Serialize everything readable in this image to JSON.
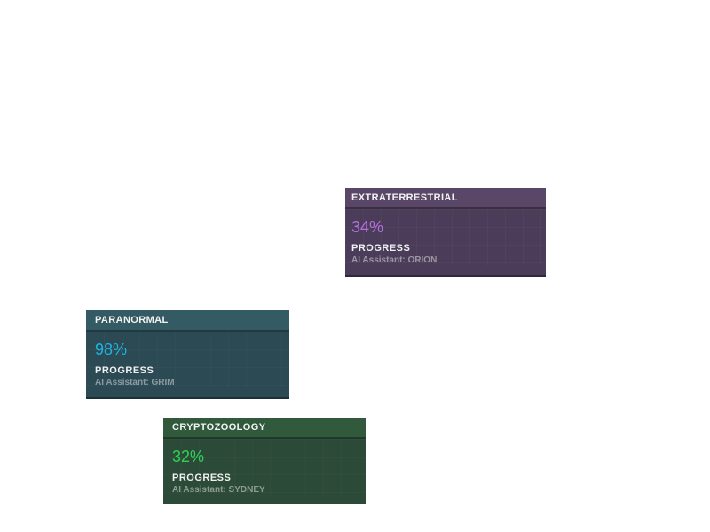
{
  "cards": [
    {
      "title": "EXTRATERRESTRIAL",
      "percent": "34%",
      "progress_value": 34,
      "progress_label": "PROGRESS",
      "assistant": "AI Assistant: ORION",
      "accent_color": "#b46fe0"
    },
    {
      "title": "PARANORMAL",
      "percent": "98%",
      "progress_value": 98,
      "progress_label": "PROGRESS",
      "assistant": "AI Assistant: GRIM",
      "accent_color": "#1fb5e0"
    },
    {
      "title": "CRYPTOZOOLOGY",
      "percent": "32%",
      "progress_value": 32,
      "progress_label": "PROGRESS",
      "assistant": "AI Assistant: SYDNEY",
      "accent_color": "#2ed156"
    }
  ]
}
